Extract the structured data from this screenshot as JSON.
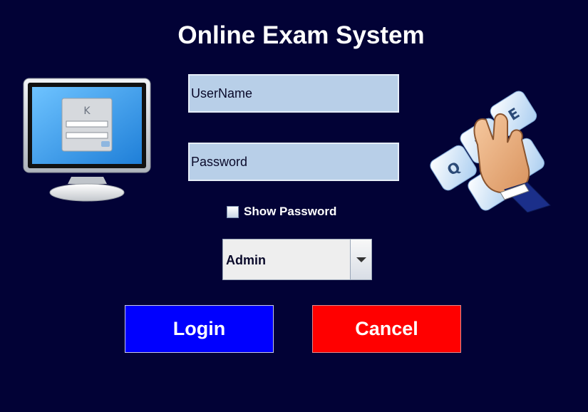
{
  "window": {
    "title": "Online Exam System"
  },
  "form": {
    "username_placeholder": "UserName",
    "password_placeholder": "Password",
    "show_password_label": "Show Password",
    "show_password_checked": false,
    "role_selected": "Admin",
    "login_label": "Login",
    "cancel_label": "Cancel"
  },
  "colors": {
    "background": "#020236",
    "field_bg": "#b8cfe8",
    "login_bg": "#0000ff",
    "cancel_bg": "#ff0000"
  },
  "icons": [
    "monitor-login-illustration",
    "keyboard-hand-illustration",
    "chevron-down-icon"
  ]
}
